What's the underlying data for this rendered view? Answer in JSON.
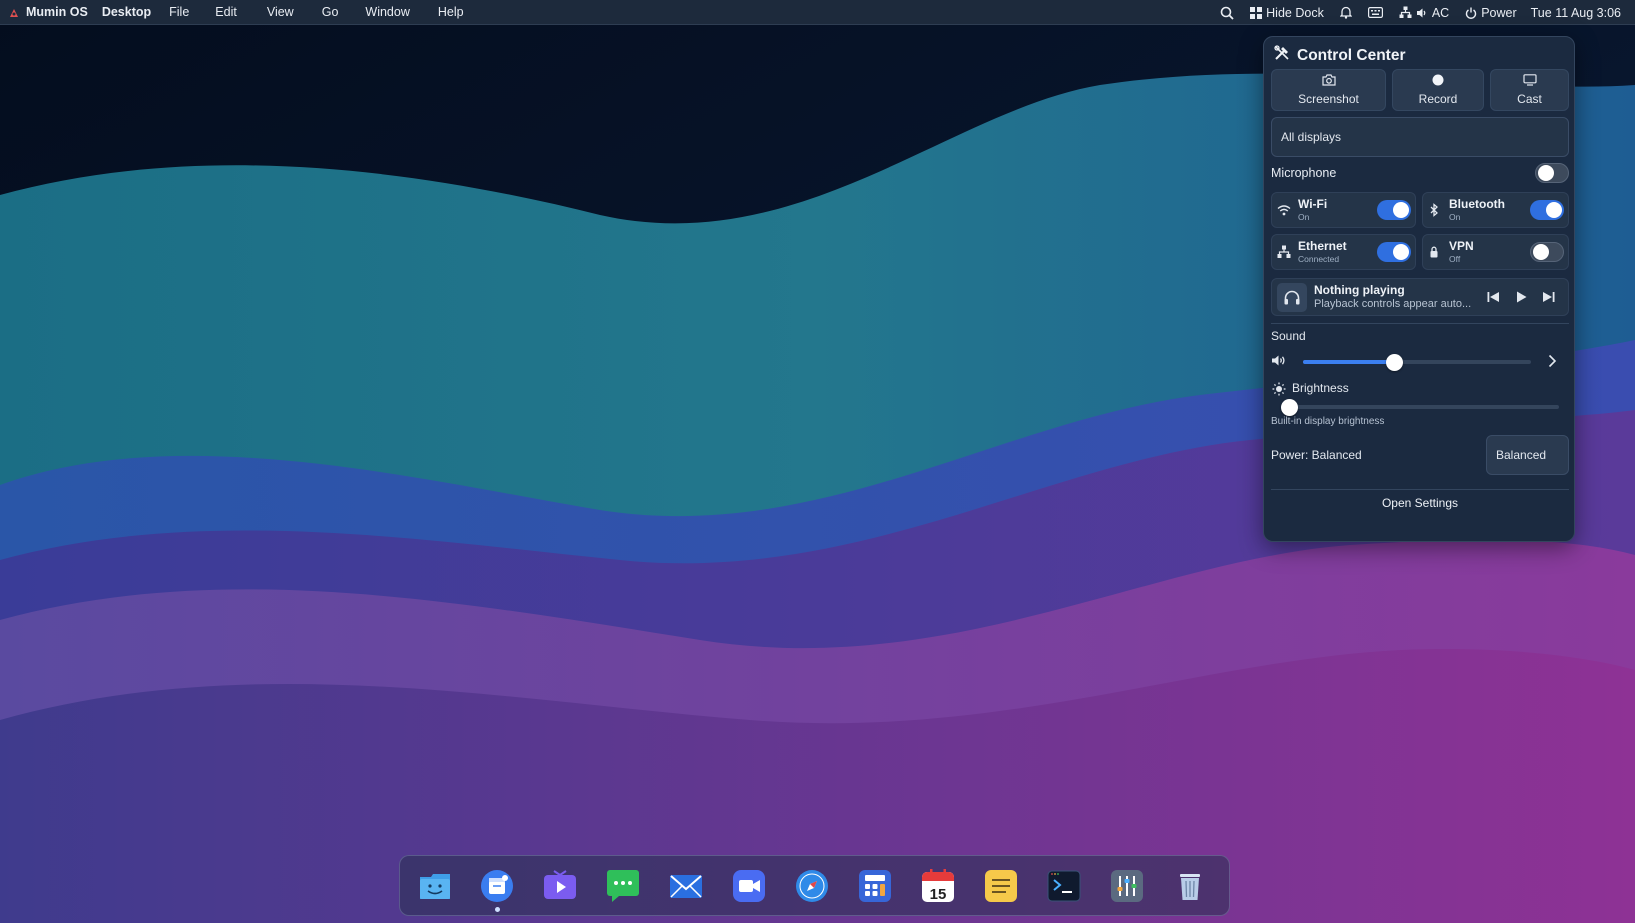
{
  "menubar": {
    "app_name": "Mumin OS",
    "menus": [
      "Desktop",
      "File",
      "Edit",
      "View",
      "Go",
      "Window",
      "Help"
    ],
    "hide_dock_label": "Hide Dock",
    "power_source": "AC",
    "power_label": "Power",
    "clock": "Tue 11 Aug  3:06"
  },
  "control_center": {
    "title": "Control Center",
    "capture_buttons": [
      {
        "label": "Screenshot",
        "icon": "camera-icon"
      },
      {
        "label": "Record",
        "icon": "record-icon"
      },
      {
        "label": "Cast",
        "icon": "cast-icon"
      }
    ],
    "display_select": "All displays",
    "microphone": {
      "label": "Microphone",
      "enabled": false
    },
    "tiles": [
      {
        "name": "Wi-Fi",
        "status": "On",
        "enabled": true,
        "icon": "wifi-icon"
      },
      {
        "name": "Bluetooth",
        "status": "On",
        "enabled": true,
        "icon": "bluetooth-icon"
      },
      {
        "name": "Ethernet",
        "status": "Connected",
        "enabled": true,
        "icon": "ethernet-icon"
      },
      {
        "name": "VPN",
        "status": "Off",
        "enabled": false,
        "icon": "lock-icon"
      }
    ],
    "media": {
      "title": "Nothing playing",
      "subtitle": "Playback controls appear auto..."
    },
    "sound": {
      "label": "Sound",
      "level": 0.4
    },
    "brightness": {
      "label": "Brightness",
      "level": 0.0,
      "note": "Built-in display brightness"
    },
    "power": {
      "label": "Power: Balanced",
      "mode": "Balanced"
    },
    "open_settings": "Open Settings"
  },
  "dock": {
    "apps": [
      "finder-icon",
      "app-store-icon",
      "video-player-icon",
      "messages-icon",
      "mail-icon",
      "video-call-icon",
      "browser-compass-icon",
      "calculator-icon",
      "calendar-icon",
      "notes-icon",
      "terminal-icon",
      "system-settings-icon",
      "trash-icon"
    ],
    "calendar_day": "15"
  },
  "colors": {
    "accent": "#2f6fe0",
    "panel_bg": "#1b2a40",
    "menubar_bg": "#1d2a3c"
  }
}
